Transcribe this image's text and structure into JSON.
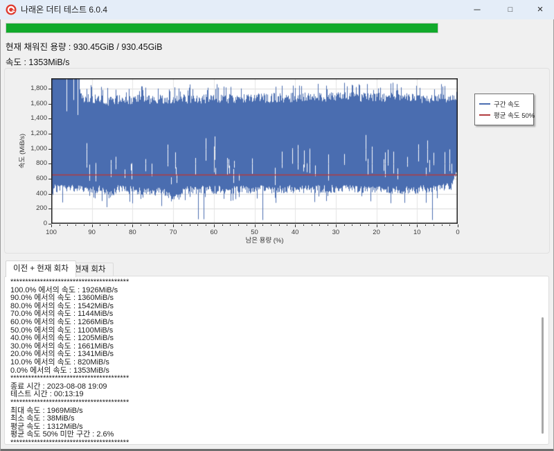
{
  "window": {
    "title": "나래온 더티 테스트 6.0.4",
    "controls": {
      "minimize": "─",
      "maximize": "□",
      "close": "×"
    }
  },
  "colors": {
    "titlebar_bg": "#e4edf8",
    "window_bg": "#f0f0f0",
    "progress_green": "#12aa2b",
    "series_blue": "#4a6db0",
    "average_red": "#b23b3e"
  },
  "progress": {
    "value_percent": 100
  },
  "status": {
    "capacity_label": "현재 채워진 용량 : 930.45GiB / 930.45GiB",
    "speed_label": "속도 : 1353MiB/s"
  },
  "chart_data": {
    "type": "line",
    "xlabel": "남은 용량 (%)",
    "ylabel": "속도 (MiB/s)",
    "xlim": [
      100,
      0
    ],
    "ylim": [
      0,
      1940
    ],
    "x_ticks": [
      100,
      90,
      80,
      70,
      60,
      50,
      40,
      30,
      20,
      10,
      0
    ],
    "x_minor_tick_step": 2,
    "y_ticks": [
      0,
      200,
      400,
      600,
      800,
      1000,
      1200,
      1400,
      1600,
      1800
    ],
    "grid": true,
    "legend": {
      "position": "outside-right",
      "entries": [
        {
          "label": "구간 속도",
          "color": "#4a6db0"
        },
        {
          "label": "평균 속도 50%",
          "color": "#b23b3e"
        }
      ]
    },
    "series": [
      {
        "name": "구간 속도",
        "render": "noisy-band",
        "color": "#4a6db0",
        "checkpoints": {
          "x": [
            100,
            90,
            80,
            70,
            60,
            50,
            40,
            30,
            20,
            10,
            0
          ],
          "y": [
            1926,
            1360,
            1542,
            1144,
            1266,
            1100,
            1205,
            1661,
            1341,
            820,
            1353
          ]
        },
        "envelope": [
          [
            100,
            1940,
            300
          ],
          [
            99.5,
            1940,
            470
          ],
          [
            93.2,
            1940,
            470
          ],
          [
            92.8,
            1750,
            470
          ],
          [
            88,
            1720,
            460
          ],
          [
            86,
            1700,
            380
          ],
          [
            84,
            1720,
            460
          ],
          [
            72,
            1730,
            420
          ],
          [
            70.5,
            1710,
            350
          ],
          [
            68.5,
            1720,
            360
          ],
          [
            67,
            1730,
            450
          ],
          [
            50,
            1740,
            460
          ],
          [
            30,
            1760,
            465
          ],
          [
            10,
            1740,
            450
          ],
          [
            1.5,
            1750,
            500
          ],
          [
            0.5,
            1760,
            650
          ],
          [
            0,
            1760,
            650
          ]
        ],
        "top_gaps": [
          [
            96.3,
            1500
          ],
          [
            94.6,
            1650
          ],
          [
            93.6,
            1450
          ]
        ],
        "deep_dips": [
          [
            63.9,
            60
          ],
          [
            62.6,
            60
          ],
          [
            48.0,
            50
          ],
          [
            6.3,
            50
          ]
        ]
      },
      {
        "name": "평균 속도 50%",
        "render": "hline",
        "color": "#b23b3e",
        "value": 656
      }
    ]
  },
  "tabs": [
    {
      "label": "이전 + 현재 회차",
      "active": true
    },
    {
      "label": "현재 회차",
      "active": false
    }
  ],
  "log": {
    "lines": [
      "****************************************",
      "100.0% 에서의 속도 : 1926MiB/s",
      "90.0% 에서의 속도 : 1360MiB/s",
      "80.0% 에서의 속도 : 1542MiB/s",
      "70.0% 에서의 속도 : 1144MiB/s",
      "60.0% 에서의 속도 : 1266MiB/s",
      "50.0% 에서의 속도 : 1100MiB/s",
      "40.0% 에서의 속도 : 1205MiB/s",
      "30.0% 에서의 속도 : 1661MiB/s",
      "20.0% 에서의 속도 : 1341MiB/s",
      "10.0% 에서의 속도 : 820MiB/s",
      "0.0% 에서의 속도 : 1353MiB/s",
      "****************************************",
      "종료 시간 : 2023-08-08 19:09",
      "테스트 시간 : 00:13:19",
      "****************************************",
      "최대 속도 : 1969MiB/s",
      "최소 속도 : 38MiB/s",
      "평균 속도 : 1312MiB/s",
      "평균 속도 50% 미만 구간 : 2.6%",
      "****************************************"
    ]
  }
}
